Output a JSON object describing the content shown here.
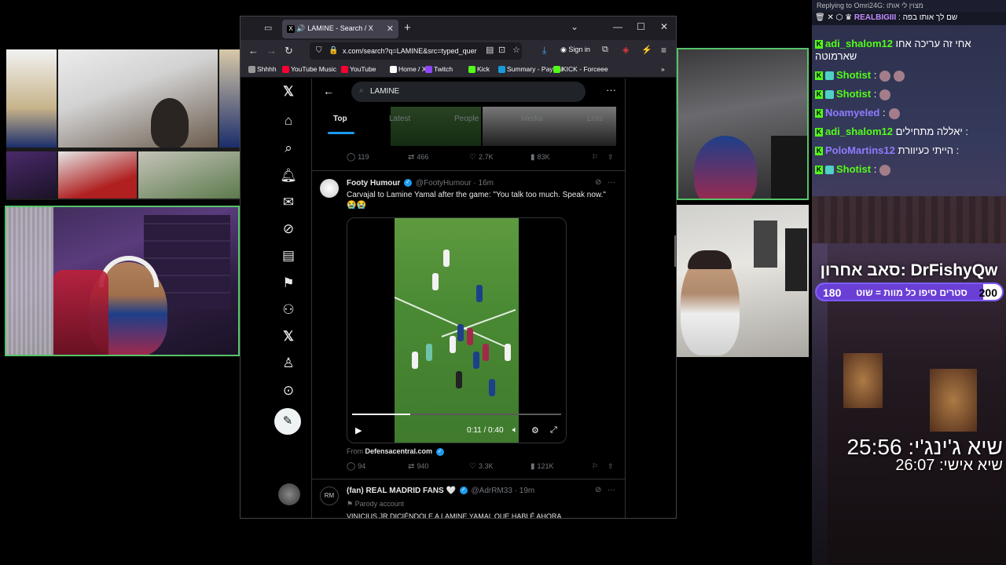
{
  "overlay": {
    "reply_bar": "Replying to Omri24G: מצוין לי אותו",
    "chat_top_name": "REALBIGIII",
    "chat_top_text": ": שם לך אותו בפה",
    "chat": [
      {
        "user": "adi_shalom12",
        "user_color": "#53fc18",
        "text": "אחי זה עריכה אחו",
        "text2": "שארמוטה",
        "badge": false,
        "emotes": 0
      },
      {
        "user": "Shotist",
        "user_color": "#53fc18",
        "text": ":",
        "badge": true,
        "emotes": 2
      },
      {
        "user": "Shotist",
        "user_color": "#53fc18",
        "text": ":",
        "badge": true,
        "emotes": 1
      },
      {
        "user": "Noamyeled",
        "user_color": "#8f7bff",
        "text": ":",
        "badge": false,
        "emotes": 1
      },
      {
        "user": "adi_shalom12",
        "user_color": "#53fc18",
        "text": "יאללה מתחילים :",
        "badge": false,
        "emotes": 0
      },
      {
        "user": "PoloMartins12",
        "user_color": "#8f7bff",
        "text": "הייתי כעיוורת :",
        "badge": false,
        "emotes": 0
      },
      {
        "user": "Shotist",
        "user_color": "#53fc18",
        "text": ":",
        "badge": true,
        "emotes": 1
      }
    ],
    "last_sub_label": "סאב אחרון: DrFishyQw",
    "sub_goal_left": "180",
    "sub_goal_text": "סטרים סיפו כל מוות = שוט",
    "sub_goal_right": "200",
    "sub_goal_fraction": 0.9,
    "timer_main": "שיא ג'ינג'י: 25:56",
    "timer_personal": "שיא אישי: 26:07"
  },
  "browser": {
    "tab_title": "LAMINE - Search / X",
    "url": "x.com/search?q=LAMINE&src=typed_quer",
    "sign_in": "Sign in",
    "bookmarks": [
      {
        "label": "Shhhh",
        "color": "#999999"
      },
      {
        "label": "YouTube Music",
        "color": "#ff0033"
      },
      {
        "label": "YouTube",
        "color": "#ff0033"
      },
      {
        "label": "Home / X",
        "color": "#ffffff"
      },
      {
        "label": "Twitch",
        "color": "#9146ff"
      },
      {
        "label": "Kick",
        "color": "#53fc18"
      },
      {
        "label": "Summary - PayPal",
        "color": "#179bd7"
      },
      {
        "label": "KICK - Forceee",
        "color": "#53fc18"
      }
    ]
  },
  "x": {
    "search_query": "LAMINE",
    "tabs": [
      "Top",
      "Latest",
      "People",
      "Media",
      "Lists"
    ],
    "tweet1_actions": {
      "replies": "119",
      "reposts": "466",
      "likes": "2.7K",
      "views": "83K"
    },
    "tweet2": {
      "name": "Footy Humour",
      "handle": "@FootyHumour · 16m",
      "text": "Carvajal to Lamine Yamal after the game: \"You talk too much. Speak now.\"",
      "emoji": "😭😭",
      "video_time": "0:11 / 0:40",
      "video_progress": 0.28,
      "from_label": "From",
      "from_source": "Defensacentral.com",
      "actions": {
        "replies": "94",
        "reposts": "940",
        "likes": "3.3K",
        "views": "121K"
      }
    },
    "tweet3": {
      "name": "(fan) REAL MADRID FANS 🤍",
      "handle": "@AdrRM33 · 19m",
      "parody": "Parody account",
      "text": "VINICIUS JR DICIÉNDOLE A LAMINE YAMAL QUE HABLÉ AHORA"
    }
  }
}
